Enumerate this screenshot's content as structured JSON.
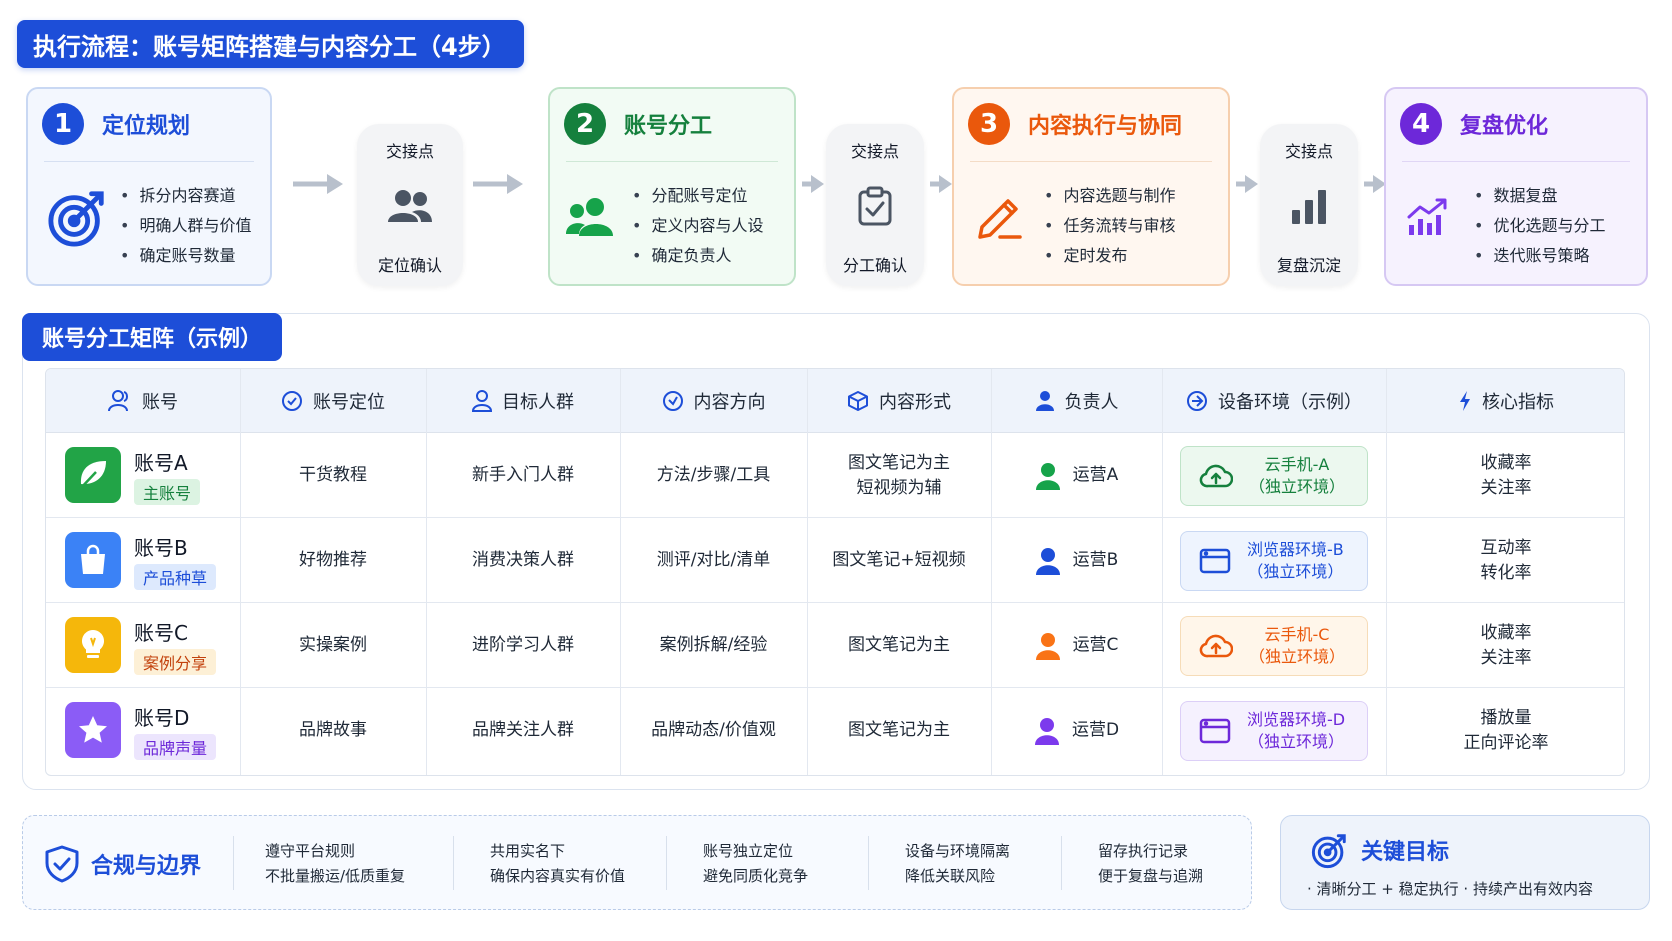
{
  "title": "执行流程：账号矩阵搭建与内容分工（4步）",
  "steps": [
    {
      "num": "1",
      "title": "定位规划",
      "icon": "target-icon",
      "items": [
        "拆分内容赛道",
        "明确人群与价值",
        "确定账号数量"
      ],
      "accent": "#1d4ed8",
      "bg": "#f3f7fe",
      "border": "#c9d8f3"
    },
    {
      "num": "2",
      "title": "账号分工",
      "icon": "users-icon",
      "items": [
        "分配账号定位",
        "定义内容与人设",
        "确定负责人"
      ],
      "accent": "#15803d",
      "bg": "#f2fbf4",
      "border": "#bfe3c8"
    },
    {
      "num": "3",
      "title": "内容执行与协同",
      "icon": "pencil-icon",
      "items": [
        "内容选题与制作",
        "任务流转与审核",
        "定时发布"
      ],
      "accent": "#ea580c",
      "bg": "#fff7f0",
      "border": "#f6cfae"
    },
    {
      "num": "4",
      "title": "复盘优化",
      "icon": "growth-chart-icon",
      "items": [
        "数据复盘",
        "优化选题与分工",
        "迭代账号策略"
      ],
      "accent": "#6d28d9",
      "bg": "#f6f2fe",
      "border": "#d6c8f3"
    }
  ],
  "handoffs": [
    {
      "label": "交接点",
      "name": "定位确认",
      "icon": "users-icon"
    },
    {
      "label": "交接点",
      "name": "分工确认",
      "icon": "clipboard-check-icon"
    },
    {
      "label": "交接点",
      "name": "复盘沉淀",
      "icon": "bar-chart-icon"
    }
  ],
  "matrix": {
    "title": "账号分工矩阵（示例）",
    "headers": [
      "账号",
      "账号定位",
      "目标人群",
      "内容方向",
      "内容形式",
      "负责人",
      "设备环境（示例）",
      "核心指标"
    ],
    "header_icons": [
      "user-icon",
      "check-circle-icon",
      "person-icon",
      "compass-icon",
      "cube-icon",
      "owner-icon",
      "device-link-icon",
      "lightning-icon"
    ],
    "rows": [
      {
        "name": "账号A",
        "tag": "主账号",
        "icon": "leaf-icon",
        "color": "#22a447",
        "tag_bg": "#dcf3e2",
        "tag_fg": "#15803d",
        "positioning": "干货教程",
        "audience": "新手入门人群",
        "direction": "方法/步骤/工具",
        "format": [
          "图文笔记为主",
          "短视频为辅"
        ],
        "owner": "运营A",
        "owner_color": "#16a34a",
        "env": [
          "云手机-A",
          "（独立环境）"
        ],
        "env_icon": "cloud-upload-icon",
        "env_color": "#15803d",
        "env_bg": "#ecf8ef",
        "env_border": "#bfe3c8",
        "metrics": [
          "收藏率",
          "关注率"
        ]
      },
      {
        "name": "账号B",
        "tag": "产品种草",
        "icon": "shopping-bag-icon",
        "color": "#3b82f6",
        "tag_bg": "#dde9fd",
        "tag_fg": "#1d4ed8",
        "positioning": "好物推荐",
        "audience": "消费决策人群",
        "direction": "测评/对比/清单",
        "format": [
          "图文笔记+短视频"
        ],
        "owner": "运营B",
        "owner_color": "#1d4ed8",
        "env": [
          "浏览器环境-B",
          "（独立环境）"
        ],
        "env_icon": "browser-window-icon",
        "env_color": "#1d4ed8",
        "env_bg": "#eef4fe",
        "env_border": "#c9d8f3",
        "metrics": [
          "互动率",
          "转化率"
        ]
      },
      {
        "name": "账号C",
        "tag": "案例分享",
        "icon": "lightbulb-icon",
        "color": "#f5b70b",
        "tag_bg": "#fdf0d6",
        "tag_fg": "#c2410c",
        "positioning": "实操案例",
        "audience": "进阶学习人群",
        "direction": "案例拆解/经验",
        "format": [
          "图文笔记为主"
        ],
        "owner": "运营C",
        "owner_color": "#f97316",
        "env": [
          "云手机-C",
          "（独立环境）"
        ],
        "env_icon": "cloud-upload-icon",
        "env_color": "#ea580c",
        "env_bg": "#fff6ea",
        "env_border": "#f6dcb8",
        "metrics": [
          "收藏率",
          "关注率"
        ]
      },
      {
        "name": "账号D",
        "tag": "品牌声量",
        "icon": "star-icon",
        "color": "#8b5cf6",
        "tag_bg": "#ece5fd",
        "tag_fg": "#6d28d9",
        "positioning": "品牌故事",
        "audience": "品牌关注人群",
        "direction": "品牌动态/价值观",
        "format": [
          "图文笔记为主"
        ],
        "owner": "运营D",
        "owner_color": "#7c3aed",
        "env": [
          "浏览器环境-D",
          "（独立环境）"
        ],
        "env_icon": "browser-window-icon",
        "env_color": "#6d28d9",
        "env_bg": "#f5f1fe",
        "env_border": "#dccff7",
        "metrics": [
          "播放量",
          "正向评论率"
        ]
      }
    ]
  },
  "compliance": {
    "title": "合规与边界",
    "icon": "shield-check-icon",
    "items": [
      [
        "遵守平台规则",
        "不批量搬运/低质重复"
      ],
      [
        "共用实名下",
        "确保内容真实有价值"
      ],
      [
        "账号独立定位",
        "避免同质化竞争"
      ],
      [
        "设备与环境隔离",
        "降低关联风险"
      ],
      [
        "留存执行记录",
        "便于复盘与追溯"
      ]
    ]
  },
  "goal": {
    "title": "关键目标",
    "icon": "target-icon",
    "subtitle": "· 清晰分工 + 稳定执行 · 持续产出有效内容"
  }
}
